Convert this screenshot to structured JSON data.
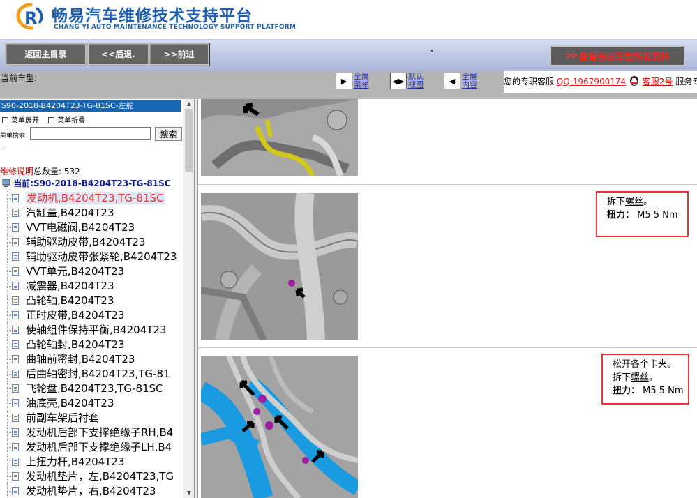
{
  "header": {
    "title": "畅易汽车维修技术支持平台",
    "subtitle": "CHANG YI AUTO MAINTENANCE TECHNOLOGY SUPPORT PLATFORM"
  },
  "toolbar": {
    "home_label": "返回主目录",
    "back_label": "<<后退.",
    "forward_label": ">>前进",
    "all_info_label": "查看当前车型所有资料",
    "all_info_arrows": ">>"
  },
  "carbar": {
    "current_car_label": "当前车型:",
    "view_buttons": [
      {
        "line1": "全屏",
        "line2": "菜单"
      },
      {
        "line1": "默认",
        "line2": "视图"
      },
      {
        "line1": "全屏",
        "line2": "内容"
      }
    ],
    "service_prefix": "您的专职客服",
    "service_qq": "QQ:1967900174",
    "service_kf": "客服2号",
    "service_suffix": "服务专"
  },
  "sidebar": {
    "model": "S90-2018-B4204T23-TG-81SC-左舵",
    "expand_label": "菜单展开",
    "collapse_label": "菜单折叠",
    "search_label": "菜单搜索",
    "search_value": "",
    "search_button": "搜索",
    "dots": "..",
    "count_prefix": "维修说明",
    "count_label": "总数量:",
    "count_value": "532",
    "current_prefix": "当前:",
    "current_value": "S90-2018-B4204T23-TG-81SC",
    "items": [
      "发动机,B4204T23,TG-81SC",
      "汽缸盖,B4204T23",
      "VVT电磁阀,B4204T23",
      "辅助驱动皮带,B4204T23",
      "辅助驱动皮带张紧轮,B4204T23",
      "VVT单元,B4204T23",
      "减震器,B4204T23",
      "凸轮轴,B4204T23",
      "正时皮带,B4204T23",
      "使轴组件保持平衡,B4204T23",
      "凸轮轴封,B4204T23",
      "曲轴前密封,B4204T23",
      "后曲轴密封,B4204T23,TG-81",
      "飞轮盘,B4204T23,TG-81SC",
      "油底壳,B4204T23",
      "前副车架后衬套",
      "发动机后部下支撑绝缘子RH,B4",
      "发动机后部下支撑绝缘子LH,B4",
      "上扭力杆,B4204T23",
      "发动机垫片，左,B4204T23,TG",
      "发动机垫片，右,B4204T23"
    ]
  },
  "content": {
    "step2": {
      "line1_pre": "拆下",
      "line1_link": "螺丝",
      "line1_post": "。",
      "torque_label": "扭力：",
      "torque_value": "M5 5 Nm"
    },
    "step3": {
      "line0": "松开各个卡夹。",
      "line1_pre": "拆下",
      "line1_link": "螺丝",
      "line1_post": "。",
      "torque_label": "扭力：",
      "torque_value": "M5 5 Nm"
    }
  },
  "colors": {
    "brand_blue": "#1e5fb0",
    "model_bar": "#1766b3",
    "note_border": "#e53535",
    "selected_text": "#e03030",
    "hose_yellow": "#d2c818",
    "hose_blue": "#1a9ae0",
    "bolt_purple": "#9b1f9e"
  }
}
